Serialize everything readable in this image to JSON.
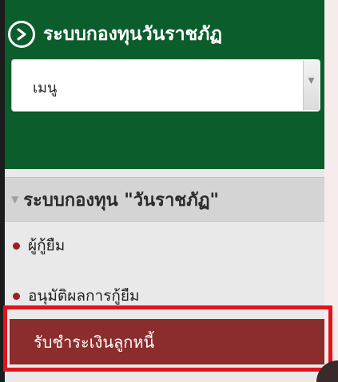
{
  "header": {
    "title": "ระบบกองทุนวันราชภัฏ",
    "icon": "chevron-right-circle-icon"
  },
  "menu_select": {
    "selected": "เมนู"
  },
  "menu": {
    "section_title": "ระบบกองทุน \"วันราชภัฏ\"",
    "items": [
      {
        "label": "ผู้กู้ยืม"
      },
      {
        "label": "อนุมัติผลการกู้ยืม"
      }
    ],
    "active_item": {
      "label": "รับชำระเงินลูกหนี้"
    }
  },
  "colors": {
    "sidebar_green": "#0b5e2b",
    "active_red": "#8b2d2d",
    "highlight": "#e0141e"
  }
}
